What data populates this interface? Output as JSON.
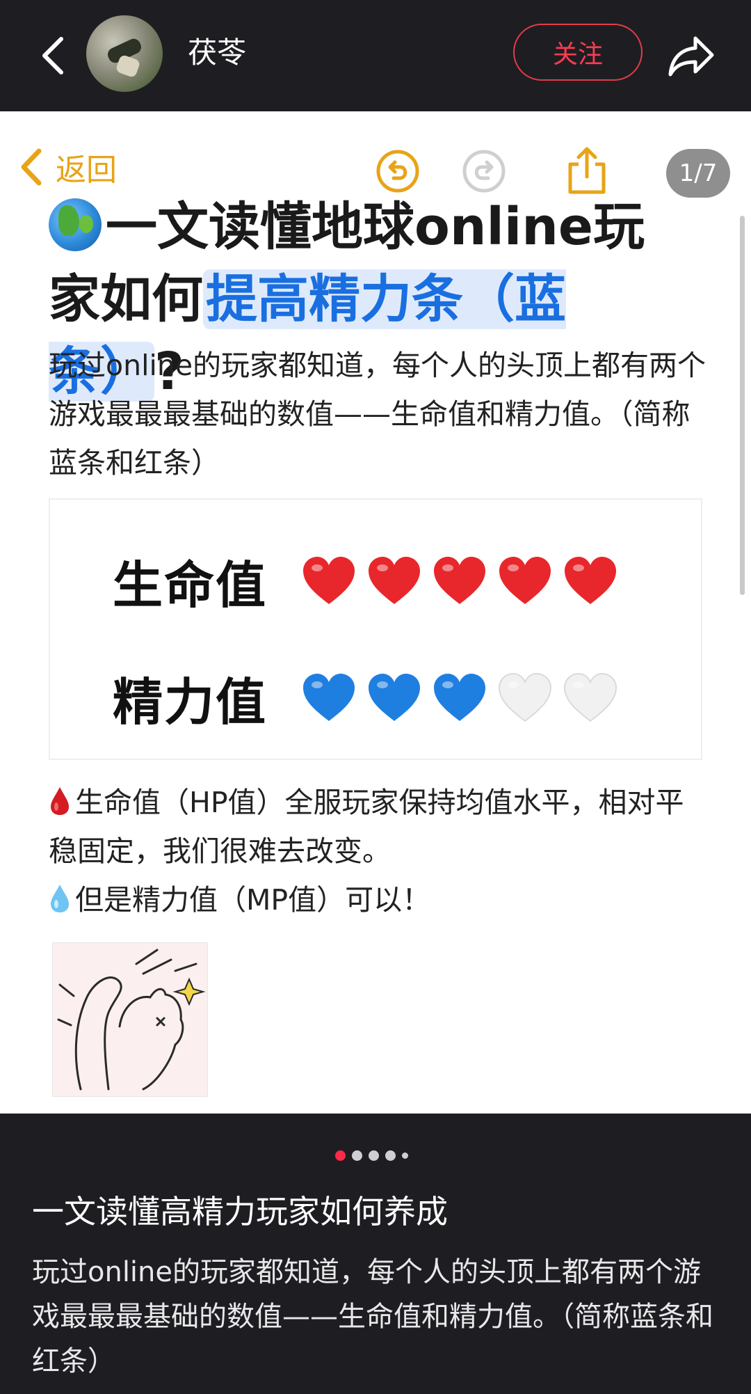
{
  "header": {
    "username": "茯苓",
    "follow_label": "关注"
  },
  "card": {
    "notes_back_label": "返回",
    "page_indicator": "1/7",
    "headline_part1": "一文读懂地球online玩家如何",
    "headline_highlight": "提高精力条（蓝条）",
    "headline_end": "?",
    "intro": "玩过online的玩家都知道，每个人的头顶上都有两个游戏最最最基础的数值——生命值和精力值。（简称蓝条和红条）",
    "stats": [
      {
        "label": "生命值",
        "filled": 5,
        "total": 5,
        "color": "#e8272c"
      },
      {
        "label": "精力值",
        "filled": 3,
        "total": 5,
        "color": "#1f7fe0"
      }
    ],
    "hp_line": "生命值（HP值）全服玩家保持均值水平，相对平稳固定，我们很难去改变。",
    "mp_line": "但是精力值（MP值）可以！"
  },
  "carousel": {
    "count": 5,
    "active_index": 0
  },
  "caption": {
    "title": "一文读懂高精力玩家如何养成",
    "body": "玩过online的玩家都知道，每个人的头顶上都有两个游戏最最最基础的数值——生命值和精力值。（简称蓝条和红条）"
  },
  "icons": {
    "back": "chevron-left-icon",
    "share": "share-arrow-icon",
    "undo": "undo-icon",
    "redo": "redo-icon",
    "upload": "share-upload-icon",
    "globe": "globe-emoji-icon",
    "blood_drop": "blood-drop-icon",
    "water_drop": "water-drop-icon"
  }
}
